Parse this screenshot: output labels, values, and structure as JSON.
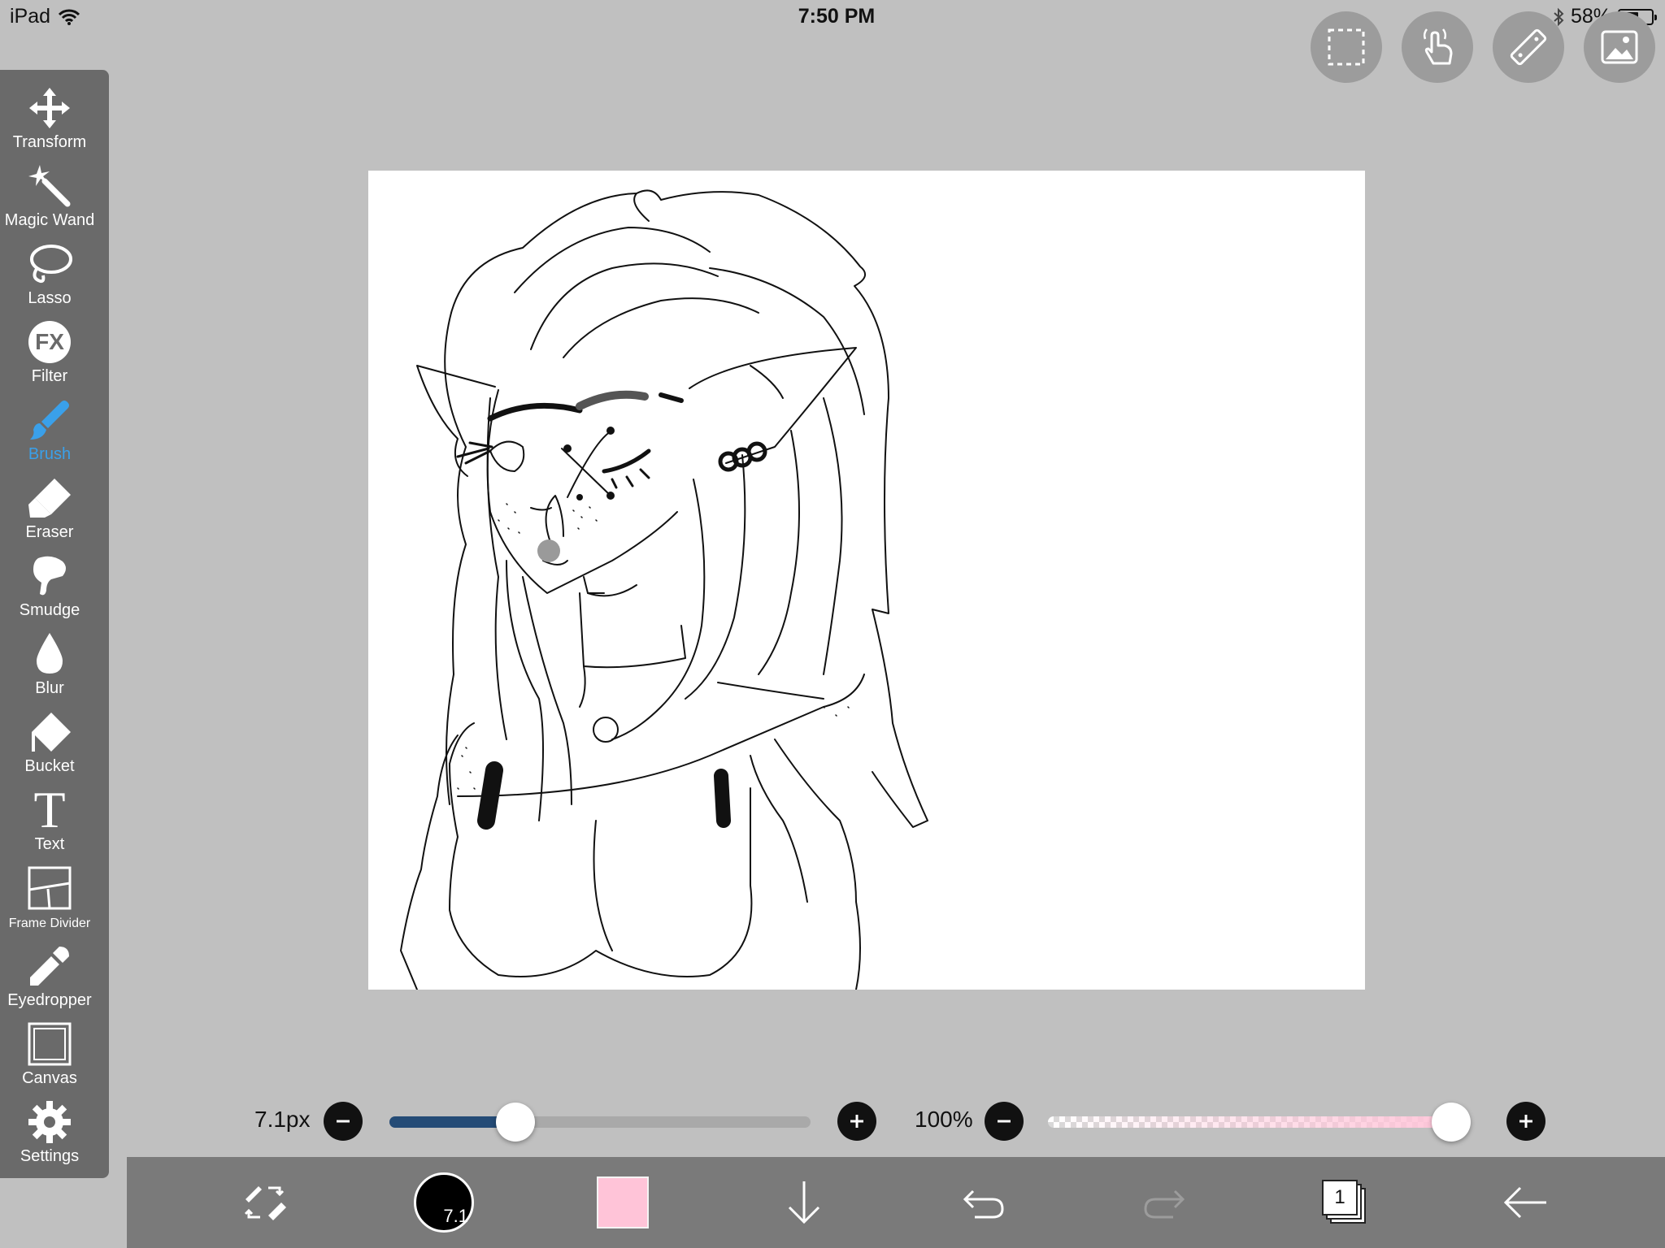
{
  "status_bar": {
    "device": "iPad",
    "time": "7:50 PM",
    "battery_text": "58%",
    "battery_level": 0.58
  },
  "top_tools": [
    {
      "name": "selection",
      "icon": "dashed-selection-icon"
    },
    {
      "name": "gesture",
      "icon": "hand-tap-icon"
    },
    {
      "name": "ruler",
      "icon": "ruler-icon"
    },
    {
      "name": "material",
      "icon": "image-icon"
    }
  ],
  "toolbar": {
    "items": [
      {
        "label": "Transform",
        "icon": "move-arrows-icon"
      },
      {
        "label": "Magic Wand",
        "icon": "magic-wand-icon"
      },
      {
        "label": "Lasso",
        "icon": "lasso-icon"
      },
      {
        "label": "Filter",
        "icon": "fx-icon",
        "glyph": "FX"
      },
      {
        "label": "Brush",
        "icon": "brush-icon",
        "active": true
      },
      {
        "label": "Eraser",
        "icon": "eraser-icon"
      },
      {
        "label": "Smudge",
        "icon": "smudge-icon"
      },
      {
        "label": "Blur",
        "icon": "droplet-icon"
      },
      {
        "label": "Bucket",
        "icon": "bucket-icon"
      },
      {
        "label": "Text",
        "icon": "text-icon",
        "glyph": "T"
      },
      {
        "label": "Frame Divider",
        "icon": "frame-divider-icon"
      },
      {
        "label": "Eyedropper",
        "icon": "eyedropper-icon"
      },
      {
        "label": "Canvas",
        "icon": "canvas-icon"
      },
      {
        "label": "Settings",
        "icon": "gear-icon"
      }
    ]
  },
  "brush_size": {
    "label": "7.1px",
    "value": 7.1,
    "fraction": 0.3
  },
  "opacity": {
    "label": "100%",
    "value": 100,
    "fraction": 1.0
  },
  "bottom_bar": {
    "brush_size_badge": "7.1",
    "current_color": "#ffc4d8",
    "layer_count": "1"
  },
  "colors": {
    "accent": "#3aa0ea",
    "toolbar_bg": "#6a6a6a",
    "size_track": "#244b76",
    "opacity_fill": "#ffc4d8"
  }
}
